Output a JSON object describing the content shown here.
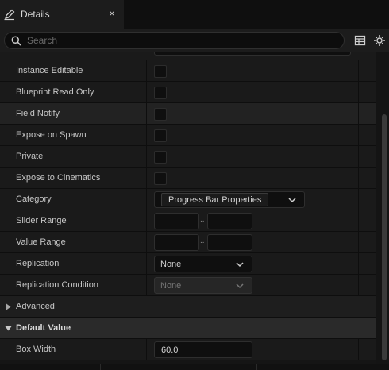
{
  "tab": {
    "title": "Details",
    "close": "×",
    "icon": "pencil-icon"
  },
  "search": {
    "placeholder": "Search",
    "value": ""
  },
  "toolbar": {
    "table_view": "table-icon",
    "settings": "gear-icon"
  },
  "properties": {
    "instance_editable": {
      "label": "Instance Editable",
      "checked": false
    },
    "blueprint_read_only": {
      "label": "Blueprint Read Only",
      "checked": false
    },
    "field_notify": {
      "label": "Field Notify",
      "checked": false
    },
    "expose_on_spawn": {
      "label": "Expose on Spawn",
      "checked": false
    },
    "private": {
      "label": "Private",
      "checked": false
    },
    "expose_to_cinematics": {
      "label": "Expose to Cinematics",
      "checked": false
    },
    "category": {
      "label": "Category",
      "value": "Progress Bar Properties"
    },
    "slider_range": {
      "label": "Slider Range",
      "min": "",
      "max": "",
      "separator": ".."
    },
    "value_range": {
      "label": "Value Range",
      "min": "",
      "max": "",
      "separator": ".."
    },
    "replication": {
      "label": "Replication",
      "value": "None"
    },
    "replication_condition": {
      "label": "Replication Condition",
      "value": "None",
      "enabled": false
    }
  },
  "sections": {
    "advanced": {
      "label": "Advanced",
      "expanded": false
    },
    "default_value": {
      "label": "Default Value",
      "expanded": true
    }
  },
  "default_value": {
    "box_width": {
      "label": "Box Width",
      "value": "60.0"
    }
  },
  "colors": {
    "panel": "#1a1a1a",
    "highlight": "#222222",
    "category_header": "#2a2a2a",
    "text": "#c6c6c6"
  }
}
